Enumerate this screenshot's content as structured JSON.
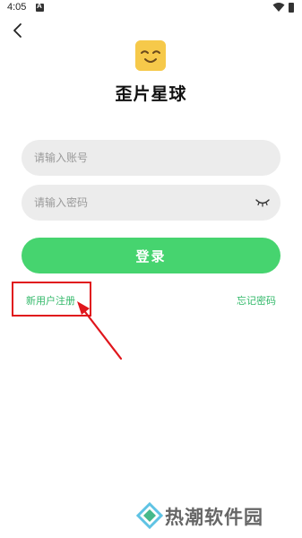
{
  "status_bar": {
    "time": "4:05",
    "icons": [
      "a-notification-icon",
      "wifi-icon",
      "battery-icon"
    ]
  },
  "header": {
    "back_icon": "chevron-left-icon"
  },
  "app": {
    "logo_icon": "smiling-face-logo-icon",
    "logo_color": "#f6c94a",
    "title": "歪片星球"
  },
  "form": {
    "account_placeholder": "请输入账号",
    "password_placeholder": "请输入密码",
    "password_toggle_icon": "eye-closed-icon",
    "login_label": "登录",
    "register_label": "新用户注册",
    "forgot_label": "忘记密码"
  },
  "colors": {
    "accent": "#46d46f",
    "link": "#33b96a",
    "annotation": "#e0161c"
  },
  "watermark": {
    "text": "热潮软件园"
  }
}
